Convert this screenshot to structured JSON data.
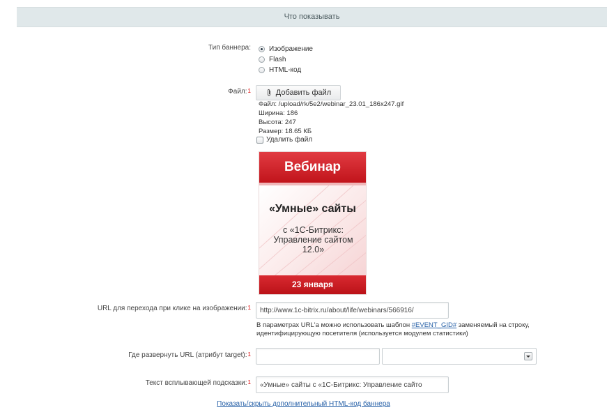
{
  "section": {
    "title": "Что показывать"
  },
  "banner_type": {
    "label": "Тип баннера:",
    "options": [
      {
        "label": "Изображение",
        "checked": true
      },
      {
        "label": "Flash",
        "checked": false
      },
      {
        "label": "HTML-код",
        "checked": false
      }
    ]
  },
  "file": {
    "label": "Файл:",
    "required_mark": "1",
    "add_button": "Добавить файл",
    "info": [
      "Файл: /upload/rk/5e2/webinar_23.01_186x247.gif",
      "Ширина: 186",
      "Высота: 247",
      "Размер: 18.65 КБ"
    ],
    "delete_label": "Удалить файл"
  },
  "banner_preview": {
    "top": "Вебинар",
    "title": "«Умные» сайты",
    "subtitle": "с «1С-Битрикс: Управление сайтом 12.0»",
    "date": "23 января"
  },
  "url": {
    "label": "URL для перехода при клике на изображении:",
    "required_mark": "1",
    "value": "http://www.1c-bitrix.ru/about/life/webinars/566916/",
    "hint_before": "В параметрах URL'а можно использовать шаблон ",
    "hint_link": "#EVENT_GID#",
    "hint_after": " заменяемый на строку, идентифицирующую посетителя (используется модулем статистики)"
  },
  "target": {
    "label": "Где развернуть URL (атрибут target):",
    "required_mark": "1",
    "value": "",
    "select_value": ""
  },
  "tooltip": {
    "label": "Текст всплывающей подсказки:",
    "required_mark": "1",
    "value": "«Умные» сайты с «1С-Битрикс: Управление сайто"
  },
  "toggle_link": "Показать/скрыть дополнительный HTML-код баннера"
}
